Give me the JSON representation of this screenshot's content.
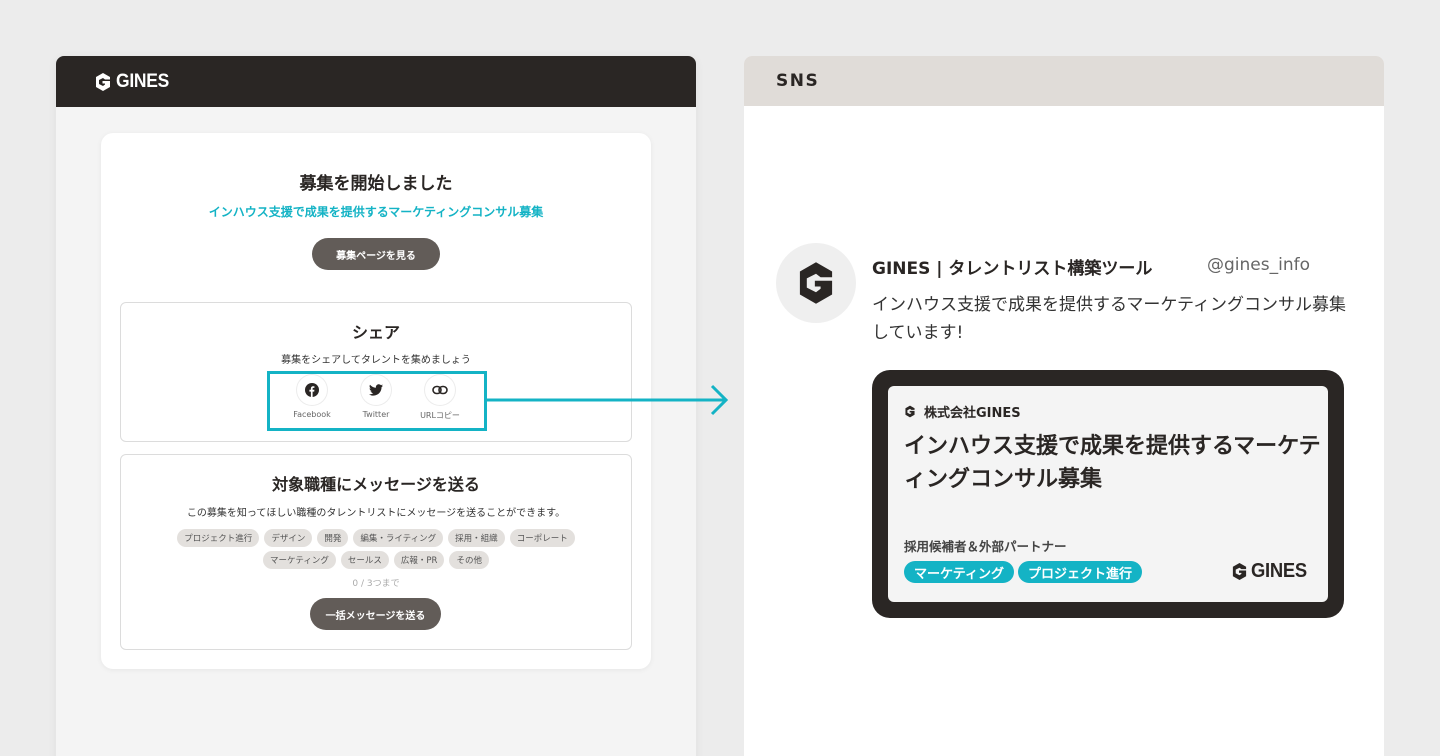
{
  "app": {
    "logo_text": "GINES",
    "card": {
      "title": "募集を開始しました",
      "subtitle": "インハウス支援で成果を提供するマーケティングコンサル募集",
      "view_button": "募集ページを見る"
    },
    "share": {
      "title": "シェア",
      "description": "募集をシェアしてタレントを集めましょう",
      "items": [
        {
          "label": "Facebook",
          "icon": "facebook-icon"
        },
        {
          "label": "Twitter",
          "icon": "twitter-icon"
        },
        {
          "label": "URLコピー",
          "icon": "link-icon"
        }
      ]
    },
    "message": {
      "title": "対象職種にメッセージを送る",
      "description": "この募集を知ってほしい職種のタレントリストにメッセージを送ることができます。",
      "tags_row1": [
        "プロジェクト進行",
        "デザイン",
        "開発",
        "編集・ライティング",
        "採用・組織",
        "コーポレート"
      ],
      "tags_row2": [
        "マーケティング",
        "セールス",
        "広報・PR",
        "その他"
      ],
      "count": "0 / 3つまで",
      "send_button": "一括メッセージを送る"
    }
  },
  "sns": {
    "header": "SNS",
    "post": {
      "name": "GINES | タレントリスト構築ツール",
      "handle": "@gines_info",
      "text": "インハウス支援で成果を提供するマーケティングコンサル募集しています!"
    },
    "preview": {
      "company": "株式会社GINES",
      "headline": "インハウス支援で成果を提供するマーケティングコンサル募集",
      "target": "採用候補者＆外部パートナー",
      "tags": [
        "マーケティング",
        "プロジェクト進行"
      ],
      "logo_text": "GINES"
    }
  },
  "colors": {
    "accent": "#14b3c5",
    "dark": "#2a2624",
    "button": "#625c58"
  }
}
